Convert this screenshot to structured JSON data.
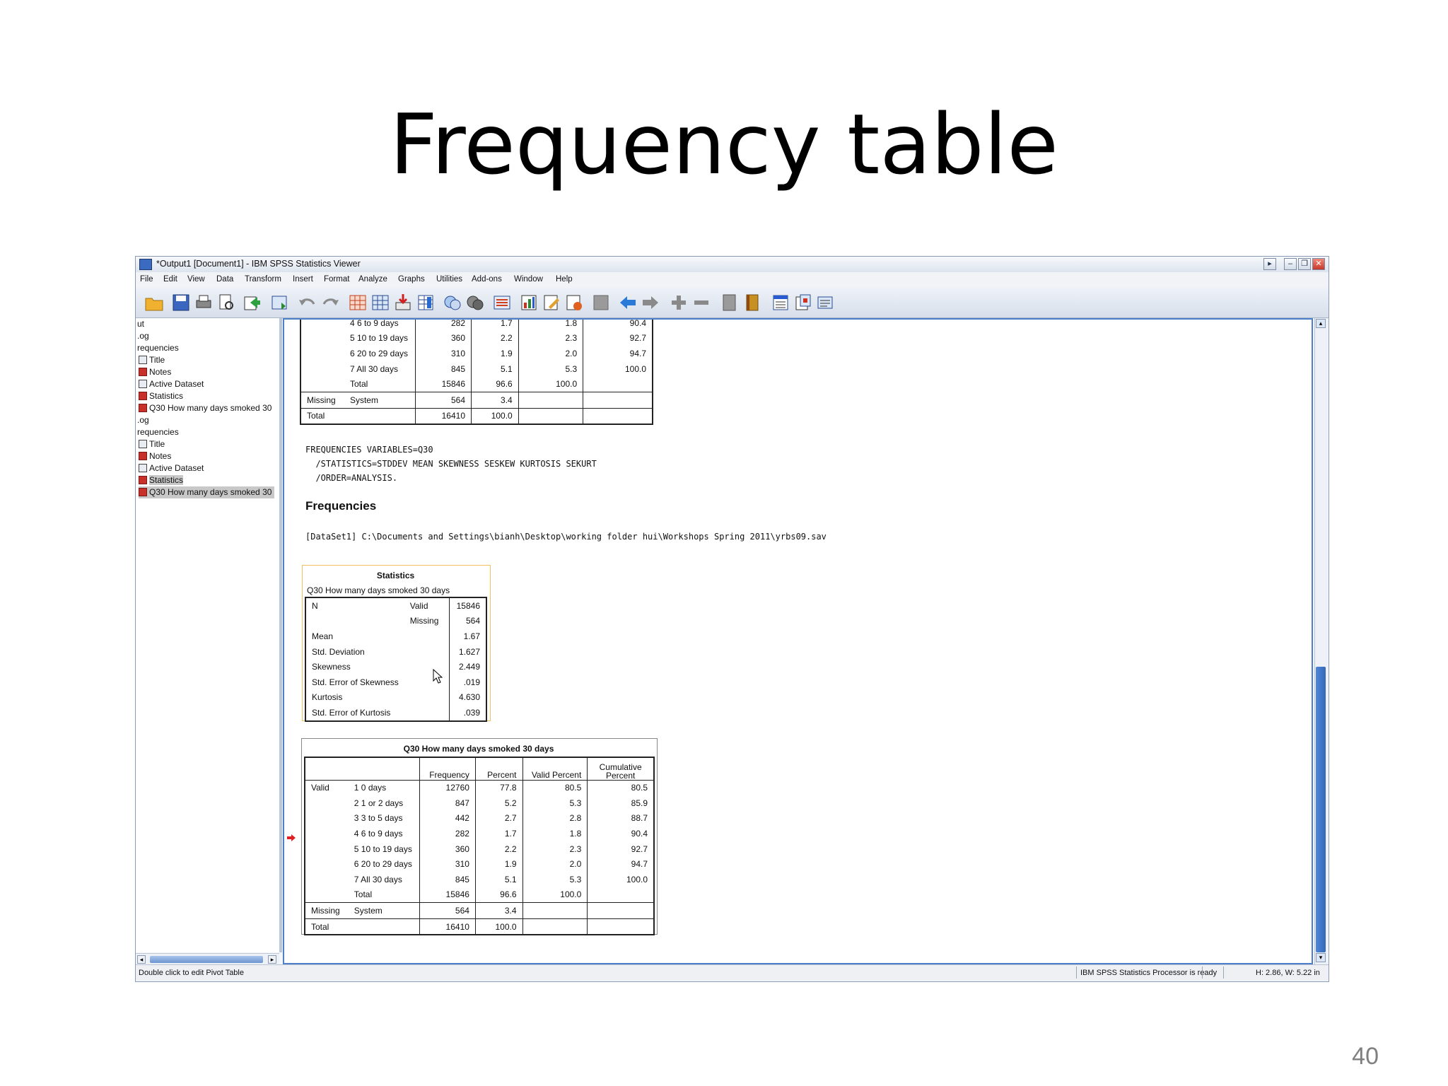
{
  "slide": {
    "title": "Frequency table",
    "page_number": "40"
  },
  "window": {
    "title": "*Output1 [Document1] - IBM SPSS Statistics Viewer"
  },
  "menu": [
    "File",
    "Edit",
    "View",
    "Data",
    "Transform",
    "Insert",
    "Format",
    "Analyze",
    "Graphs",
    "Utilities",
    "Add-ons",
    "Window",
    "Help"
  ],
  "outline": {
    "items": [
      "ut",
      ".og",
      "requencies",
      "Title",
      "Notes",
      "Active Dataset",
      "Statistics",
      "Q30 How many days smoked 30",
      ".og",
      "requencies",
      "Title",
      "Notes",
      "Active Dataset",
      "Statistics",
      "Q30 How many days smoked 30"
    ]
  },
  "top_table": {
    "rows": [
      {
        "label": "",
        "cat": "4 6 to 9 days",
        "freq": "282",
        "pct": "1.7",
        "vpct": "1.8",
        "cpct": "90.4"
      },
      {
        "label": "",
        "cat": "5 10 to 19 days",
        "freq": "360",
        "pct": "2.2",
        "vpct": "2.3",
        "cpct": "92.7"
      },
      {
        "label": "",
        "cat": "6 20 to 29 days",
        "freq": "310",
        "pct": "1.9",
        "vpct": "2.0",
        "cpct": "94.7"
      },
      {
        "label": "",
        "cat": "7 All 30 days",
        "freq": "845",
        "pct": "5.1",
        "vpct": "5.3",
        "cpct": "100.0"
      },
      {
        "label": "",
        "cat": "Total",
        "freq": "15846",
        "pct": "96.6",
        "vpct": "100.0",
        "cpct": ""
      },
      {
        "label": "Missing",
        "cat": "System",
        "freq": "564",
        "pct": "3.4",
        "vpct": "",
        "cpct": ""
      },
      {
        "label": "Total",
        "cat": "",
        "freq": "16410",
        "pct": "100.0",
        "vpct": "",
        "cpct": ""
      }
    ]
  },
  "syntax": {
    "line1": "FREQUENCIES VARIABLES=Q30",
    "line2": "  /STATISTICS=STDDEV MEAN SKEWNESS SESKEW KURTOSIS SEKURT",
    "line3": "  /ORDER=ANALYSIS."
  },
  "frequencies_heading": "Frequencies",
  "dataset_line": "[DataSet1] C:\\Documents and Settings\\bianh\\Desktop\\working folder hui\\Workshops Spring 2011\\yrbs09.sav",
  "stats_table": {
    "title": "Statistics",
    "subtitle": "Q30 How many days smoked 30 days",
    "rows": [
      {
        "a": "N",
        "b": "Valid",
        "v": "15846"
      },
      {
        "a": "",
        "b": "Missing",
        "v": "564"
      },
      {
        "a": "Mean",
        "b": "",
        "v": "1.67"
      },
      {
        "a": "Std. Deviation",
        "b": "",
        "v": "1.627"
      },
      {
        "a": "Skewness",
        "b": "",
        "v": "2.449"
      },
      {
        "a": "Std. Error of Skewness",
        "b": "",
        "v": ".019"
      },
      {
        "a": "Kurtosis",
        "b": "",
        "v": "4.630"
      },
      {
        "a": "Std. Error of Kurtosis",
        "b": "",
        "v": ".039"
      }
    ]
  },
  "freq_table": {
    "title": "Q30 How many days smoked 30 days",
    "headers": {
      "freq": "Frequency",
      "pct": "Percent",
      "vpct": "Valid Percent",
      "cpct1": "Cumulative",
      "cpct2": "Percent"
    },
    "rows": [
      {
        "label": "Valid",
        "cat": "1 0 days",
        "freq": "12760",
        "pct": "77.8",
        "vpct": "80.5",
        "cpct": "80.5"
      },
      {
        "label": "",
        "cat": "2 1 or 2 days",
        "freq": "847",
        "pct": "5.2",
        "vpct": "5.3",
        "cpct": "85.9"
      },
      {
        "label": "",
        "cat": "3 3 to 5 days",
        "freq": "442",
        "pct": "2.7",
        "vpct": "2.8",
        "cpct": "88.7"
      },
      {
        "label": "",
        "cat": "4 6 to 9 days",
        "freq": "282",
        "pct": "1.7",
        "vpct": "1.8",
        "cpct": "90.4"
      },
      {
        "label": "",
        "cat": "5 10 to 19 days",
        "freq": "360",
        "pct": "2.2",
        "vpct": "2.3",
        "cpct": "92.7"
      },
      {
        "label": "",
        "cat": "6 20 to 29 days",
        "freq": "310",
        "pct": "1.9",
        "vpct": "2.0",
        "cpct": "94.7"
      },
      {
        "label": "",
        "cat": "7 All 30 days",
        "freq": "845",
        "pct": "5.1",
        "vpct": "5.3",
        "cpct": "100.0"
      },
      {
        "label": "",
        "cat": "Total",
        "freq": "15846",
        "pct": "96.6",
        "vpct": "100.0",
        "cpct": ""
      },
      {
        "label": "Missing",
        "cat": "System",
        "freq": "564",
        "pct": "3.4",
        "vpct": "",
        "cpct": ""
      },
      {
        "label": "Total",
        "cat": "",
        "freq": "16410",
        "pct": "100.0",
        "vpct": "",
        "cpct": ""
      }
    ]
  },
  "status": {
    "left": "Double click to edit Pivot Table",
    "processor": "IBM SPSS Statistics Processor is ready",
    "size": "H: 2.86, W: 5.22 in"
  },
  "colors": {
    "arrow": "#e02020",
    "selection_border": "#f2c060",
    "scroll_thumb": "#3f78cf"
  }
}
